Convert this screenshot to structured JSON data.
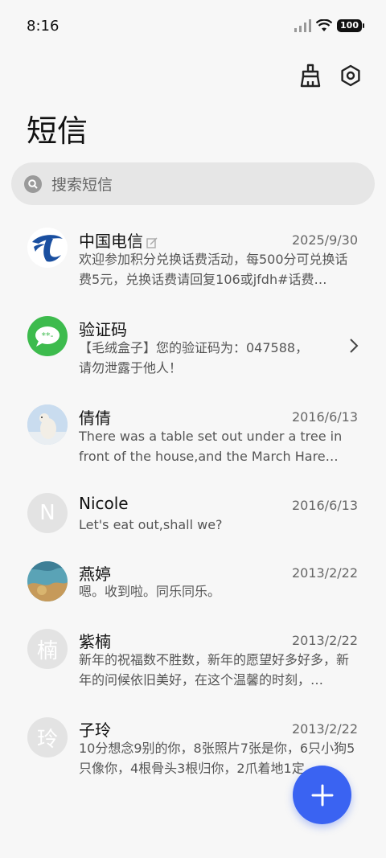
{
  "status_bar": {
    "time": "8:16",
    "battery": "100"
  },
  "header": {
    "title": "短信"
  },
  "search": {
    "placeholder": "搜索短信"
  },
  "conversations": [
    {
      "name": "中国电信",
      "date": "2025/9/30",
      "preview": "欢迎参加积分兑换话费活动，每500分可兑换话费5元，兑换话费请回复106或jfdh#话费…",
      "avatar": "china-telecom-logo"
    },
    {
      "name": "验证码",
      "date": "",
      "preview": "【毛绒盒子】您的验证码为：047588，请勿泄露于他人！",
      "avatar": "message-bubble-icon"
    },
    {
      "name": "倩倩",
      "date": "2016/6/13",
      "preview": "There was a table set out under a tree in front of the house,and the March Hare an…",
      "avatar": "polar-bear-photo"
    },
    {
      "name": "Nicole",
      "date": "2016/6/13",
      "preview": "Let's eat out,shall we?",
      "avatar_letter": "N"
    },
    {
      "name": "燕婷",
      "date": "2013/2/22",
      "preview": "嗯。收到啦。同乐同乐。",
      "avatar": "landscape-photo"
    },
    {
      "name": "紫楠",
      "date": "2013/2/22",
      "preview": "新年的祝福数不胜数，新年的愿望好多好多，新年的问候依旧美好，在这个温馨的时刻，…",
      "avatar_letter": "楠"
    },
    {
      "name": "子玲",
      "date": "2013/2/22",
      "preview": "10分想念9别的你，8张照片7张是你，6只小狗5只像你，4根骨头3根归你，2爪着地1定…",
      "avatar_letter": "玲"
    }
  ],
  "colors": {
    "accent": "#3a63f2",
    "telecom_blue": "#1a4fa0",
    "sms_green": "#3dbb4d"
  }
}
